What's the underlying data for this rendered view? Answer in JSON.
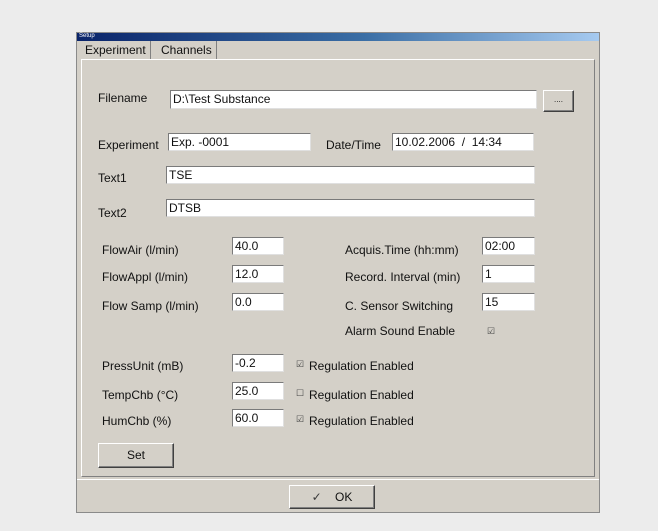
{
  "window": {
    "title": "Setup"
  },
  "tabs": [
    "Experiment",
    "Channels"
  ],
  "filename": {
    "label": "Filename",
    "value": "D:\\Test Substance",
    "browse_label": "...."
  },
  "experiment": {
    "label": "Experiment",
    "value": "Exp. -0001"
  },
  "datetime": {
    "label": "Date/Time",
    "value": "10.02.2006  /  14:34"
  },
  "text1": {
    "label": "Text1",
    "value": "TSE"
  },
  "text2": {
    "label": "Text2",
    "value": "DTSB"
  },
  "flow_air": {
    "label": "FlowAir (l/min)",
    "value": "40.0"
  },
  "flow_appl": {
    "label": "FlowAppl (l/min)",
    "value": "12.0"
  },
  "flow_samp": {
    "label": "Flow Samp (l/min)",
    "value": "0.0"
  },
  "acquis_time": {
    "label": "Acquis.Time (hh:mm)",
    "value": "02:00"
  },
  "record_interval": {
    "label": "Record. Interval (min)",
    "value": "1"
  },
  "sensor_switching": {
    "label": "C. Sensor Switching",
    "value": "15"
  },
  "alarm_sound": {
    "label": "Alarm Sound Enable",
    "checked": true
  },
  "press_unit": {
    "label": "PressUnit (mB)",
    "value": "-0.2",
    "regulation_label": "Regulation Enabled",
    "regulation_checked": true
  },
  "temp_chb": {
    "label": "TempChb (°C)",
    "value": "25.0",
    "regulation_label": "Regulation Enabled",
    "regulation_checked": false
  },
  "hum_chb": {
    "label": "HumChb (%)",
    "value": "60.0",
    "regulation_label": "Regulation Enabled",
    "regulation_checked": true
  },
  "set_button": "Set",
  "ok_button": "OK"
}
